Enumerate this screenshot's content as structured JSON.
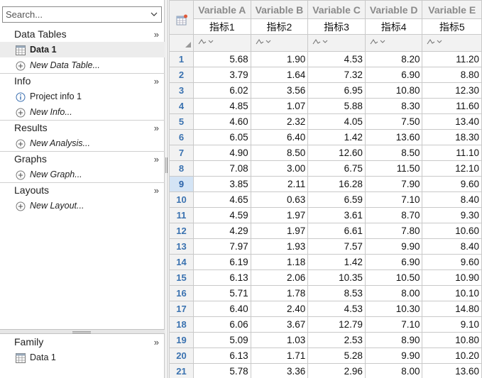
{
  "search": {
    "placeholder": "Search..."
  },
  "navigator": {
    "sections": [
      {
        "title": "Data Tables",
        "expand": "»",
        "items": [
          {
            "label": "Data 1",
            "kind": "table",
            "selected": true
          },
          {
            "label": "New Data Table...",
            "kind": "new"
          }
        ]
      },
      {
        "title": "Info",
        "expand": "»",
        "items": [
          {
            "label": "Project info 1",
            "kind": "info"
          },
          {
            "label": "New Info...",
            "kind": "new"
          }
        ]
      },
      {
        "title": "Results",
        "expand": "»",
        "items": [
          {
            "label": "New Analysis...",
            "kind": "new"
          }
        ]
      },
      {
        "title": "Graphs",
        "expand": "»",
        "items": [
          {
            "label": "New Graph...",
            "kind": "new"
          }
        ]
      },
      {
        "title": "Layouts",
        "expand": "»",
        "items": [
          {
            "label": "New Layout...",
            "kind": "new"
          }
        ]
      }
    ],
    "family": {
      "title": "Family",
      "expand": "»",
      "items": [
        {
          "label": "Data 1",
          "kind": "table"
        }
      ]
    }
  },
  "grid": {
    "columns": [
      {
        "title": "Variable A",
        "subtitle": "指标1"
      },
      {
        "title": "Variable B",
        "subtitle": "指标2"
      },
      {
        "title": "Variable C",
        "subtitle": "指标3"
      },
      {
        "title": "Variable D",
        "subtitle": "指标4"
      },
      {
        "title": "Variable E",
        "subtitle": "指标5"
      }
    ],
    "active_row": 9,
    "rows": [
      [
        "1",
        "5.68",
        "1.90",
        "4.53",
        "8.20",
        "11.20"
      ],
      [
        "2",
        "3.79",
        "1.64",
        "7.32",
        "6.90",
        "8.80"
      ],
      [
        "3",
        "6.02",
        "3.56",
        "6.95",
        "10.80",
        "12.30"
      ],
      [
        "4",
        "4.85",
        "1.07",
        "5.88",
        "8.30",
        "11.60"
      ],
      [
        "5",
        "4.60",
        "2.32",
        "4.05",
        "7.50",
        "13.40"
      ],
      [
        "6",
        "6.05",
        "6.40",
        "1.42",
        "13.60",
        "18.30"
      ],
      [
        "7",
        "4.90",
        "8.50",
        "12.60",
        "8.50",
        "11.10"
      ],
      [
        "8",
        "7.08",
        "3.00",
        "6.75",
        "11.50",
        "12.10"
      ],
      [
        "9",
        "3.85",
        "2.11",
        "16.28",
        "7.90",
        "9.60"
      ],
      [
        "10",
        "4.65",
        "0.63",
        "6.59",
        "7.10",
        "8.40"
      ],
      [
        "11",
        "4.59",
        "1.97",
        "3.61",
        "8.70",
        "9.30"
      ],
      [
        "12",
        "4.29",
        "1.97",
        "6.61",
        "7.80",
        "10.60"
      ],
      [
        "13",
        "7.97",
        "1.93",
        "7.57",
        "9.90",
        "8.40"
      ],
      [
        "14",
        "6.19",
        "1.18",
        "1.42",
        "6.90",
        "9.60"
      ],
      [
        "15",
        "6.13",
        "2.06",
        "10.35",
        "10.50",
        "10.90"
      ],
      [
        "16",
        "5.71",
        "1.78",
        "8.53",
        "8.00",
        "10.10"
      ],
      [
        "17",
        "6.40",
        "2.40",
        "4.53",
        "10.30",
        "14.80"
      ],
      [
        "18",
        "6.06",
        "3.67",
        "12.79",
        "7.10",
        "9.10"
      ],
      [
        "19",
        "5.09",
        "1.03",
        "2.53",
        "8.90",
        "10.80"
      ],
      [
        "20",
        "6.13",
        "1.71",
        "5.28",
        "9.90",
        "10.20"
      ],
      [
        "21",
        "5.78",
        "3.36",
        "2.96",
        "8.00",
        "13.60"
      ]
    ]
  },
  "colors": {
    "header_text": "#8a8a8a",
    "row_number": "#3a72b0",
    "active_row_bg": "#d4e4f5",
    "selected_item_bg": "#ececec"
  }
}
